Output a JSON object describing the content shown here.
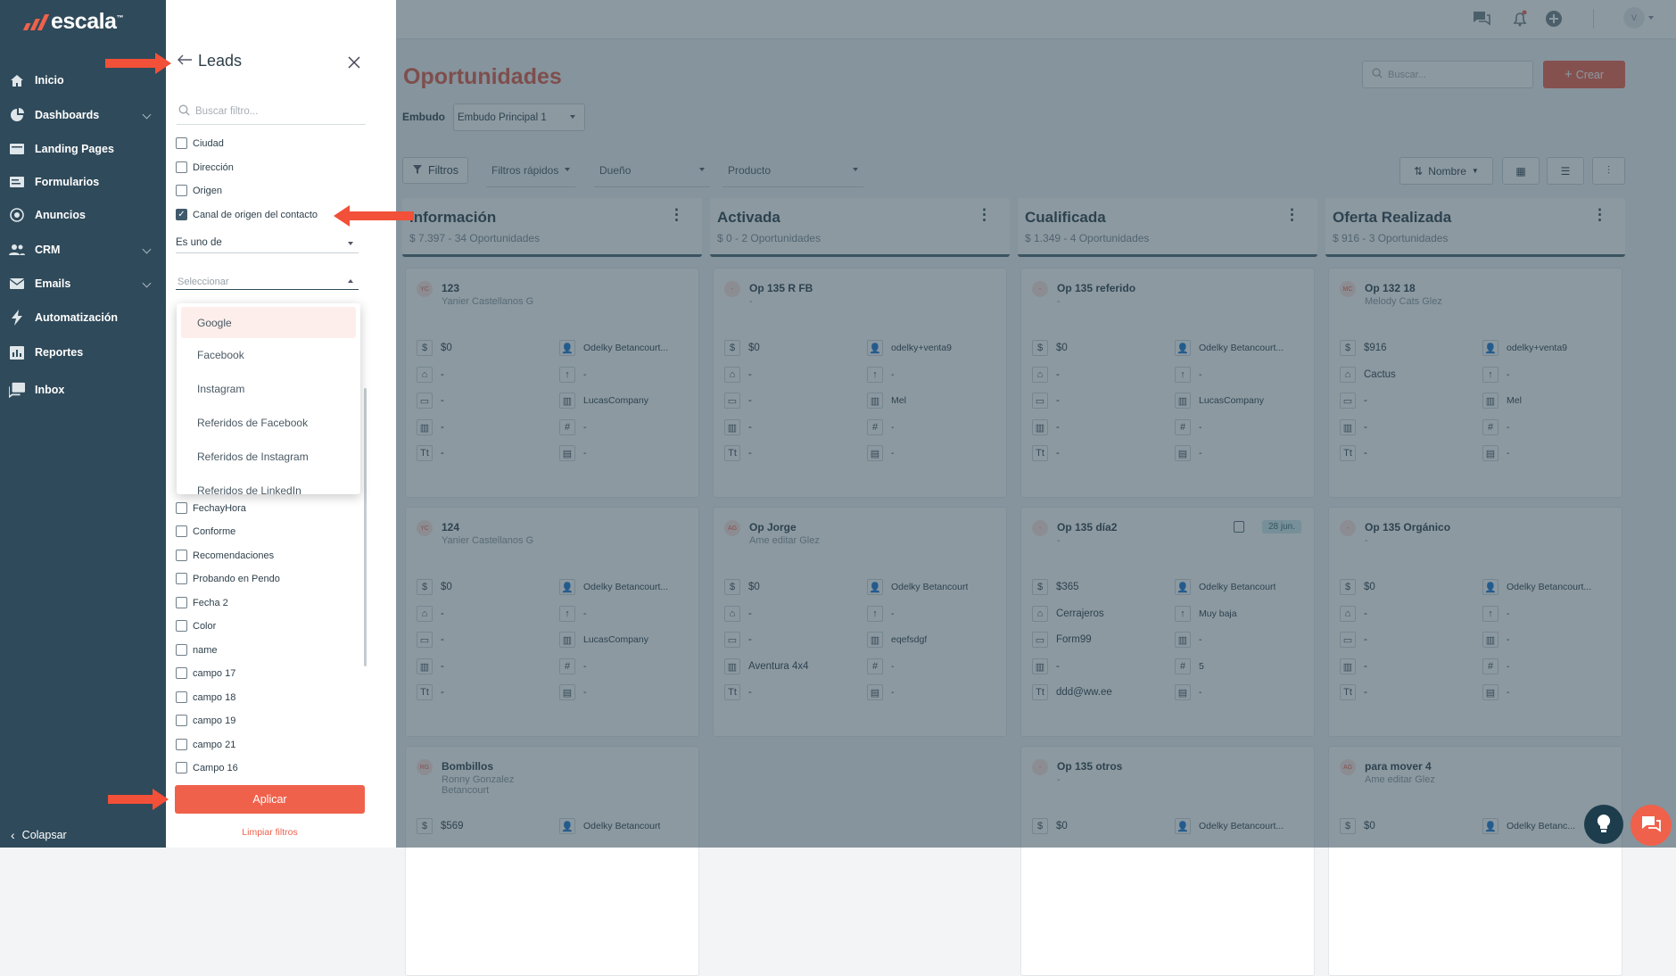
{
  "brand": {
    "name": "escala",
    "tm": "™",
    "accent": "#f0614b",
    "sidebar_bg": "#2f4a5a"
  },
  "sidebar": {
    "items": [
      {
        "label": "Inicio",
        "icon": "home-icon",
        "chevron": false
      },
      {
        "label": "Dashboards",
        "icon": "pie-chart-icon",
        "chevron": true
      },
      {
        "label": "Landing Pages",
        "icon": "landing-page-icon",
        "chevron": false
      },
      {
        "label": "Formularios",
        "icon": "form-icon",
        "chevron": false
      },
      {
        "label": "Anuncios",
        "icon": "megaphone-icon",
        "chevron": false
      },
      {
        "label": "CRM",
        "icon": "users-icon",
        "chevron": true
      },
      {
        "label": "Emails",
        "icon": "mail-icon",
        "chevron": true
      },
      {
        "label": "Automatización",
        "icon": "bolt-icon",
        "chevron": false
      },
      {
        "label": "Reportes",
        "icon": "bar-chart-icon",
        "chevron": false
      },
      {
        "label": "Inbox",
        "icon": "inbox-icon",
        "chevron": false
      }
    ],
    "collapse_label": "Colapsar"
  },
  "filter_panel": {
    "title": "Leads",
    "search_placeholder": "Buscar filtro...",
    "checkboxes_top": [
      {
        "label": "Ciudad",
        "checked": false
      },
      {
        "label": "Dirección",
        "checked": false
      },
      {
        "label": "Origen",
        "checked": false
      },
      {
        "label": "Canal de origen del contacto",
        "checked": true
      }
    ],
    "operator": "Es uno de",
    "select_placeholder": "Seleccionar",
    "dropdown_options": [
      "Google",
      "Facebook",
      "Instagram",
      "Referidos de Facebook",
      "Referidos de Instagram",
      "Referidos de LinkedIn"
    ],
    "checkboxes_bottom": [
      {
        "label": "FechayHora",
        "checked": false
      },
      {
        "label": "Conforme",
        "checked": false
      },
      {
        "label": "Recomendaciones",
        "checked": false
      },
      {
        "label": "Probando en Pendo",
        "checked": false
      },
      {
        "label": "Fecha 2",
        "checked": false
      },
      {
        "label": "Color",
        "checked": false
      },
      {
        "label": "name",
        "checked": false
      },
      {
        "label": "campo 17",
        "checked": false
      },
      {
        "label": "campo 18",
        "checked": false
      },
      {
        "label": "campo 19",
        "checked": false
      },
      {
        "label": "campo 21",
        "checked": false
      },
      {
        "label": "Campo 16",
        "checked": false
      }
    ],
    "apply_label": "Aplicar",
    "clear_label": "Limpiar filtros"
  },
  "main": {
    "title": "Oportunidades",
    "search_placeholder": "Buscar...",
    "create_label": "Crear",
    "embudo_label": "Embudo",
    "embudo_value": "Embudo Principal 1",
    "filters_label": "Filtros",
    "quick_filters": "Filtros rápidos",
    "dueno": "Dueño",
    "producto": "Producto",
    "sort_label": "Nombre",
    "avatar_initial": "V"
  },
  "columns": [
    {
      "title": "Información",
      "sub": "$ 7.397 - 34 Oportunidades"
    },
    {
      "title": "Activada",
      "sub": "$ 0 - 2 Oportunidades"
    },
    {
      "title": "Cualificada",
      "sub": "$ 1.349 - 4 Oportunidades"
    },
    {
      "title": "Oferta Realizada",
      "sub": "$ 916 - 3 Oportunidades"
    }
  ],
  "cards": [
    [
      {
        "initials": "YC",
        "title": "123",
        "sub": "Yanier Castellanos G",
        "badge": "",
        "fields": [
          "$0",
          "Odelky Betancourt...",
          "-",
          "-",
          "-",
          "LucasCompany",
          "-",
          "-",
          "-",
          "-"
        ]
      },
      {
        "initials": "YC",
        "title": "124",
        "sub": "Yanier Castellanos G",
        "badge": "",
        "fields": [
          "$0",
          "Odelky Betancourt...",
          "-",
          "-",
          "-",
          "LucasCompany",
          "-",
          "-",
          "-",
          "-"
        ]
      },
      {
        "initials": "RG",
        "title": "Bombillos",
        "sub": "Ronny Gonzalez",
        "sub2": "Betancourt",
        "badge": "",
        "fields": [
          "$569",
          "Odelky Betancourt"
        ]
      }
    ],
    [
      {
        "initials": "-",
        "title": "Op 135 R FB",
        "sub": "-",
        "badge": "",
        "fields": [
          "$0",
          "odelky+venta9",
          "-",
          "-",
          "-",
          "Mel",
          "-",
          "-",
          "-",
          "-"
        ]
      },
      {
        "initials": "AG",
        "title": "Op Jorge",
        "sub": "Ame editar Glez",
        "badge": "",
        "fields": [
          "$0",
          "Odelky Betancourt",
          "-",
          "-",
          "-",
          "eqefsdgf",
          "Aventura 4x4",
          "-",
          "-",
          "-"
        ]
      }
    ],
    [
      {
        "initials": "-",
        "title": "Op 135 referido",
        "sub": "-",
        "badge": "",
        "fields": [
          "$0",
          "Odelky Betancourt...",
          "-",
          "-",
          "-",
          "LucasCompany",
          "-",
          "-",
          "-",
          "-"
        ]
      },
      {
        "initials": "-",
        "title": "Op 135 día2",
        "sub": "-",
        "badge": "28 jun.",
        "fields": [
          "$365",
          "Odelky Betancourt",
          "Cerrajeros",
          "Muy baja",
          "Form99",
          "-",
          "-",
          "5",
          "ddd@ww.ee",
          "-"
        ]
      },
      {
        "initials": "-",
        "title": "Op 135 otros",
        "sub": "-",
        "badge": "",
        "fields": [
          "$0",
          "Odelky Betancourt..."
        ]
      }
    ],
    [
      {
        "initials": "MC",
        "title": "Op 132 18",
        "sub": "Melody Cats Glez",
        "badge": "",
        "fields": [
          "$916",
          "odelky+venta9",
          "Cactus",
          "-",
          "-",
          "Mel",
          "-",
          "-",
          "-",
          "-"
        ]
      },
      {
        "initials": "-",
        "title": "Op 135 Orgánico",
        "sub": "-",
        "badge": "",
        "fields": [
          "$0",
          "Odelky Betancourt...",
          "-",
          "-",
          "-",
          "-",
          "-",
          "-",
          "-",
          "-"
        ]
      },
      {
        "initials": "AG",
        "title": "para mover 4",
        "sub": "Ame editar Glez",
        "badge": "",
        "fields": [
          "$0",
          "Odelky Betanc..."
        ]
      }
    ]
  ],
  "field_icons": [
    "$",
    "user",
    "tag",
    "arrow-up",
    "calendar",
    "building",
    "building",
    "#",
    "Tt",
    "table"
  ]
}
